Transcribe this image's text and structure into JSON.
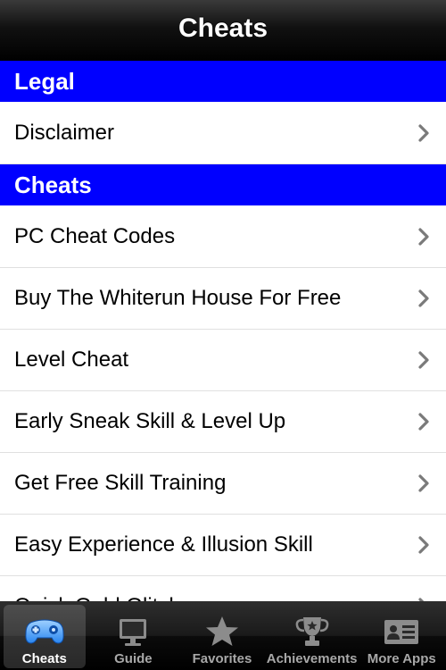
{
  "navbar": {
    "title": "Cheats"
  },
  "sections": [
    {
      "header": "Legal",
      "items": [
        "Disclaimer"
      ]
    },
    {
      "header": "Cheats",
      "items": [
        "PC Cheat Codes",
        "Buy The Whiterun House For Free",
        "Level Cheat",
        "Early Sneak Skill & Level Up",
        "Get Free Skill Training",
        "Easy Experience & Illusion Skill",
        "Quick Gold Glitch"
      ]
    }
  ],
  "tabbar": {
    "tabs": [
      {
        "label": "Cheats",
        "icon": "gamepad-icon",
        "active": true
      },
      {
        "label": "Guide",
        "icon": "monitor-icon",
        "active": false
      },
      {
        "label": "Favorites",
        "icon": "star-icon",
        "active": false
      },
      {
        "label": "Achievements",
        "icon": "trophy-icon",
        "active": false
      },
      {
        "label": "More Apps",
        "icon": "contact-card-icon",
        "active": false
      }
    ]
  },
  "colors": {
    "section_header_bg": "#0000ff",
    "navbar_bg": "#000000",
    "active_icon": "#4aa3ff",
    "inactive_icon": "#8c8c8c"
  }
}
